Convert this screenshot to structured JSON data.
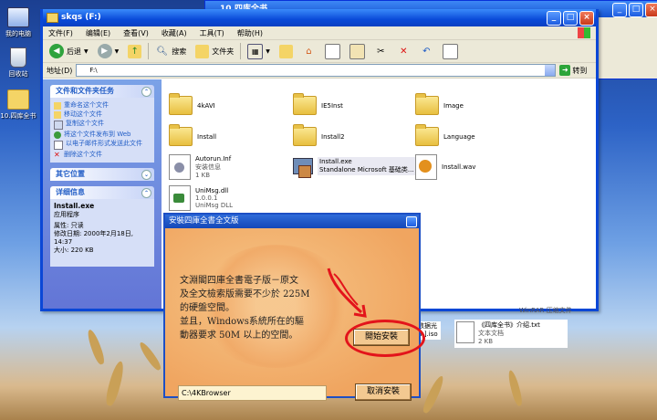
{
  "desktop": {
    "icons": [
      {
        "label": "我的电脑",
        "icon": "my-computer-icon"
      },
      {
        "label": "回收站",
        "icon": "recycle-bin-icon"
      },
      {
        "label": "10.四库全书",
        "icon": "folder-icon"
      }
    ]
  },
  "background_window": {
    "title": "10.四库全书"
  },
  "explorer": {
    "title": "skqs (F:)",
    "menu": [
      "文件(F)",
      "编辑(E)",
      "查看(V)",
      "收藏(A)",
      "工具(T)",
      "帮助(H)"
    ],
    "toolbar": {
      "back": "后退",
      "search": "搜索",
      "folders": "文件夹"
    },
    "address": {
      "label": "地址(D)",
      "value": "F:\\",
      "go": "转到"
    },
    "tasks": {
      "title": "文件和文件夹任务",
      "items": [
        "重命名这个文件",
        "移动这个文件",
        "复制这个文件",
        "将这个文件发布到 Web",
        "以电子邮件形式发送此文件",
        "删除这个文件"
      ]
    },
    "other_places": {
      "title": "其它位置"
    },
    "details": {
      "title": "详细信息",
      "name": "Install.exe",
      "type": "应用程序",
      "attributes": "属性: 只读",
      "modified": "修改日期: 2000年2月18日, 14:37",
      "size": "大小: 220 KB"
    },
    "files": [
      {
        "name": "4kAVI",
        "kind": "folder"
      },
      {
        "name": "IE5Inst",
        "kind": "folder"
      },
      {
        "name": "Image",
        "kind": "folder"
      },
      {
        "name": "Install",
        "kind": "folder"
      },
      {
        "name": "Install2",
        "kind": "folder"
      },
      {
        "name": "Language",
        "kind": "folder"
      },
      {
        "name": "Autorun.Inf",
        "line2": "安装信息",
        "line3": "1 KB",
        "kind": "inf"
      },
      {
        "name": "Install.exe",
        "line2": "Standalone Microsoft 基础类...",
        "kind": "exe"
      },
      {
        "name": "Install.wav",
        "kind": "wav"
      },
      {
        "name": "UniMsg.dll",
        "line2": "1.0.0.1",
        "line3": "UniMsg DLL",
        "kind": "dll"
      }
    ],
    "partial_files": [
      {
        "name": "WinRAR 压缩文件"
      },
      {
        "name": "数据光",
        "line2": "m].iso"
      },
      {
        "name": "《四库全书》介绍.txt",
        "line2": "文本文档",
        "line3": "2 KB"
      }
    ]
  },
  "dialog": {
    "title": "安裝四庫全書全文版",
    "message": "文淵閣四庫全書電子版－原文\n及全文檢索版需要不少於 225M\n的硬盤空間。\n並且，Windows系統所在的驅\n動器要求 50M 以上的空間。",
    "start_button": "開始安裝",
    "cancel_button": "取消安裝",
    "path": "C:\\4KBrowser"
  },
  "colors": {
    "xp_blue": "#0b47d6",
    "dialog_bg": "#f4b36d",
    "annotation_red": "#e3141b"
  }
}
